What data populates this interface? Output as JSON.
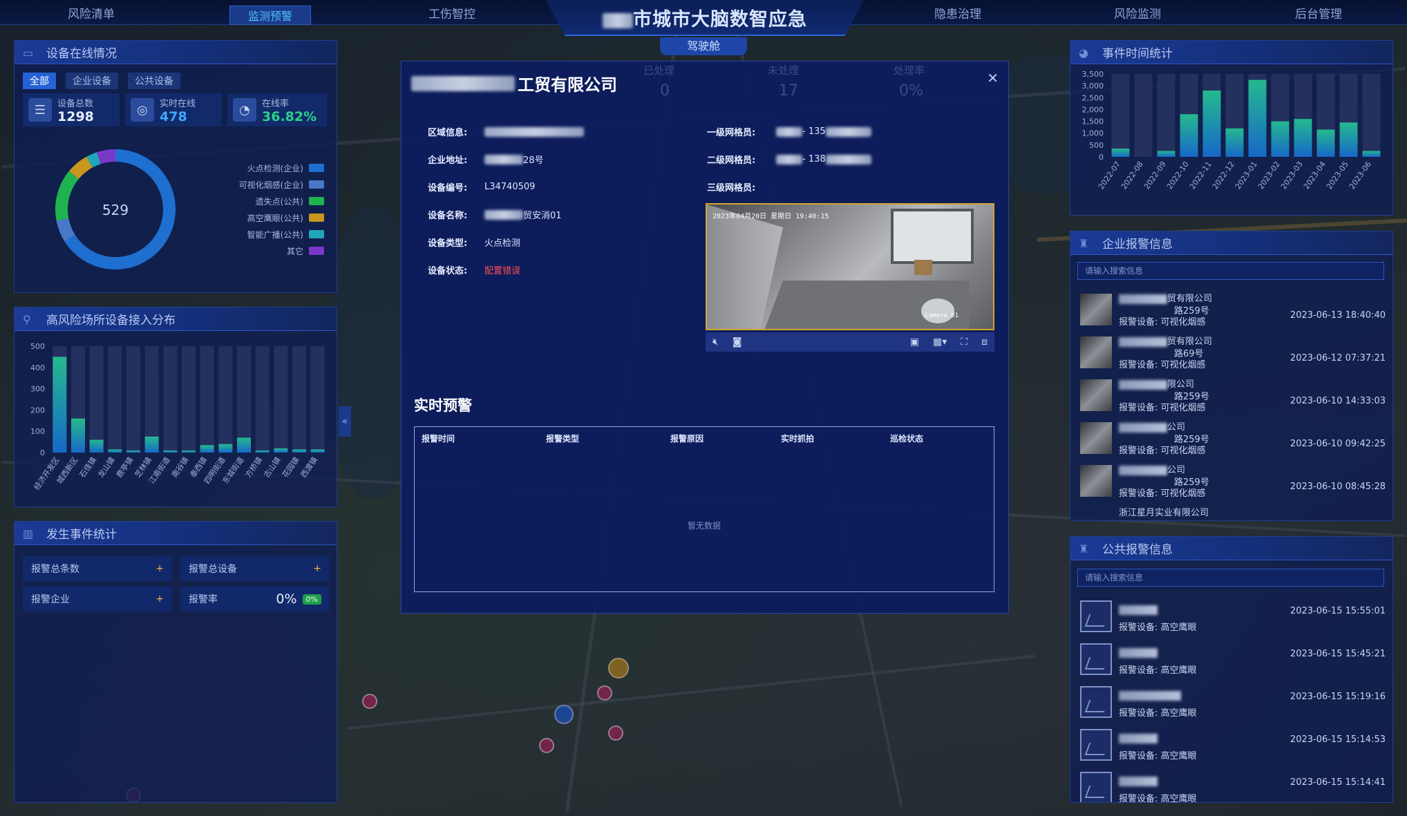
{
  "nav": {
    "left": [
      "风险清单",
      "监测预警",
      "工伤智控"
    ],
    "right": [
      "隐患治理",
      "风险监测",
      "后台管理"
    ],
    "active_index": 1,
    "title": "市城市大脑数智应急",
    "cockpit": "驾驶舱"
  },
  "device_panel": {
    "title": "设备在线情况",
    "tabs": [
      "全部",
      "企业设备",
      "公共设备"
    ],
    "stats": [
      {
        "label": "设备总数",
        "value": "1298",
        "icon": "server-icon"
      },
      {
        "label": "实时在线",
        "value": "478",
        "icon": "globe-icon"
      },
      {
        "label": "在线率",
        "value": "36.82%",
        "icon": "pie-icon"
      }
    ],
    "donut_center": "529",
    "legend": [
      {
        "label": "火点检测(企业)",
        "color": "#1f6fd1"
      },
      {
        "label": "可视化烟感(企业)",
        "color": "#4a78c8"
      },
      {
        "label": "遗失点(公共)",
        "color": "#1fb34f"
      },
      {
        "label": "高空鹰眼(公共)",
        "color": "#c9961f"
      },
      {
        "label": "智能广播(公共)",
        "color": "#20a6b8"
      },
      {
        "label": "其它",
        "color": "#7a38c9"
      }
    ],
    "donut_values": [
      66,
      6,
      14,
      6,
      3,
      5
    ]
  },
  "risk_panel": {
    "title": "高风险场所设备接入分布",
    "chart_data": {
      "type": "bar",
      "ylim": [
        0,
        500
      ],
      "yticks": [
        "500",
        "400",
        "300",
        "200",
        "100",
        "0"
      ],
      "categories": [
        "经济开发区",
        "城西新区",
        "石佳镇",
        "龙山镇",
        "鹿亭镇",
        "芝林镇",
        "江南街道",
        "南谷镇",
        "泰西镇",
        "四明街道",
        "东城街道",
        "方桥镇",
        "古山镇",
        "花园镇",
        "西渡镇"
      ],
      "total": [
        500,
        500,
        500,
        500,
        500,
        500,
        500,
        500,
        500,
        500,
        500,
        500,
        500,
        500,
        500
      ],
      "online": [
        450,
        160,
        60,
        15,
        10,
        75,
        10,
        10,
        35,
        40,
        70,
        10,
        20,
        15,
        15
      ]
    }
  },
  "event_panel": {
    "title": "发生事件统计",
    "cells": [
      {
        "label": "报警总条数",
        "value": "+"
      },
      {
        "label": "报警总设备",
        "value": "+"
      },
      {
        "label": "报警企业",
        "value": "+"
      },
      {
        "label": "报警率",
        "value": "0%",
        "badge": "0%"
      }
    ]
  },
  "modal": {
    "title_suffix": "工贸有限公司",
    "ghost_stats": [
      "已处理",
      "未处理",
      "处理率",
      "0",
      "17",
      "0%"
    ],
    "left_info": [
      {
        "label": "区域信息:",
        "value": "",
        "blur": true
      },
      {
        "label": "企业地址:",
        "value": "28号",
        "blur": true
      },
      {
        "label": "设备编号:",
        "value": "L34740509"
      },
      {
        "label": "设备名称:",
        "value": "贸安消01",
        "blur": true
      },
      {
        "label": "设备类型:",
        "value": "火点检测"
      },
      {
        "label": "设备状态:",
        "value": "配置错误",
        "error": true
      }
    ],
    "right_info": [
      {
        "label": "一级网格员:",
        "value": "- 135"
      },
      {
        "label": "二级网格员:",
        "value": "- 138"
      },
      {
        "label": "三级网格员:",
        "value": ""
      }
    ],
    "video_timestamp": "2023年04月20日 星期日 19:40:15",
    "video_camera": "Camera 01",
    "realtime_title": "实时预警",
    "table_headers": [
      "报警时间",
      "报警类型",
      "报警原因",
      "实时抓拍",
      "巡检状态"
    ],
    "empty_text": "暂无数据"
  },
  "time_panel": {
    "title": "事件时间统计",
    "chart_data": {
      "type": "bar",
      "ylim": [
        0,
        3500
      ],
      "yticks": [
        "3,500",
        "3,000",
        "2,500",
        "2,000",
        "1,500",
        "1,000",
        "500",
        "0"
      ],
      "categories": [
        "2022-07",
        "2022-08",
        "2022-09",
        "2022-10",
        "2022-11",
        "2022-12",
        "2023-01",
        "2023-02",
        "2023-03",
        "2023-04",
        "2023-05",
        "2023-06"
      ],
      "total": [
        3500,
        3500,
        3500,
        3500,
        3500,
        3500,
        3500,
        3500,
        3500,
        3500,
        3500,
        3500
      ],
      "values": [
        350,
        0,
        250,
        1800,
        2800,
        1200,
        3250,
        1500,
        1600,
        1150,
        1450,
        250
      ]
    }
  },
  "enterprise_alarm": {
    "title": "企业报警信息",
    "placeholder": "请输入搜索信息",
    "items": [
      {
        "name": "贸有限公司",
        "addr": "路259号",
        "device": "报警设备:  可视化烟感",
        "time": "2023-06-13 18:40:40"
      },
      {
        "name": "贸有限公司",
        "addr": "路69号",
        "device": "报警设备:  可视化烟感",
        "time": "2023-06-12 07:37:21"
      },
      {
        "name": "限公司",
        "addr": "路259号",
        "device": "报警设备:  可视化烟感",
        "time": "2023-06-10 14:33:03"
      },
      {
        "name": "公司",
        "addr": "路259号",
        "device": "报警设备:  可视化烟感",
        "time": "2023-06-10 09:42:25"
      },
      {
        "name": "公司",
        "addr": "路259号",
        "device": "报警设备:  可视化烟感",
        "time": "2023-06-10 08:45:28"
      }
    ],
    "partial": "浙江星月实业有限公司"
  },
  "public_alarm": {
    "title": "公共报警信息",
    "placeholder": "请输入搜索信息",
    "items": [
      {
        "device": "报警设备:  高空鹰眼",
        "time": "2023-06-15 15:55:01"
      },
      {
        "device": "报警设备:  高空鹰眼",
        "time": "2023-06-15 15:45:21"
      },
      {
        "device": "报警设备:  高空鹰眼",
        "time": "2023-06-15 15:19:16"
      },
      {
        "device": "报警设备:  高空鹰眼",
        "time": "2023-06-15 15:14:53"
      },
      {
        "device": "报警设备:  高空鹰眼",
        "time": "2023-06-15 15:14:41"
      }
    ]
  },
  "colors": {
    "accent": "#2662d6",
    "online_bar": "#1fa38a",
    "bar_bg": "#24305e",
    "error": "#ff4d4f"
  }
}
